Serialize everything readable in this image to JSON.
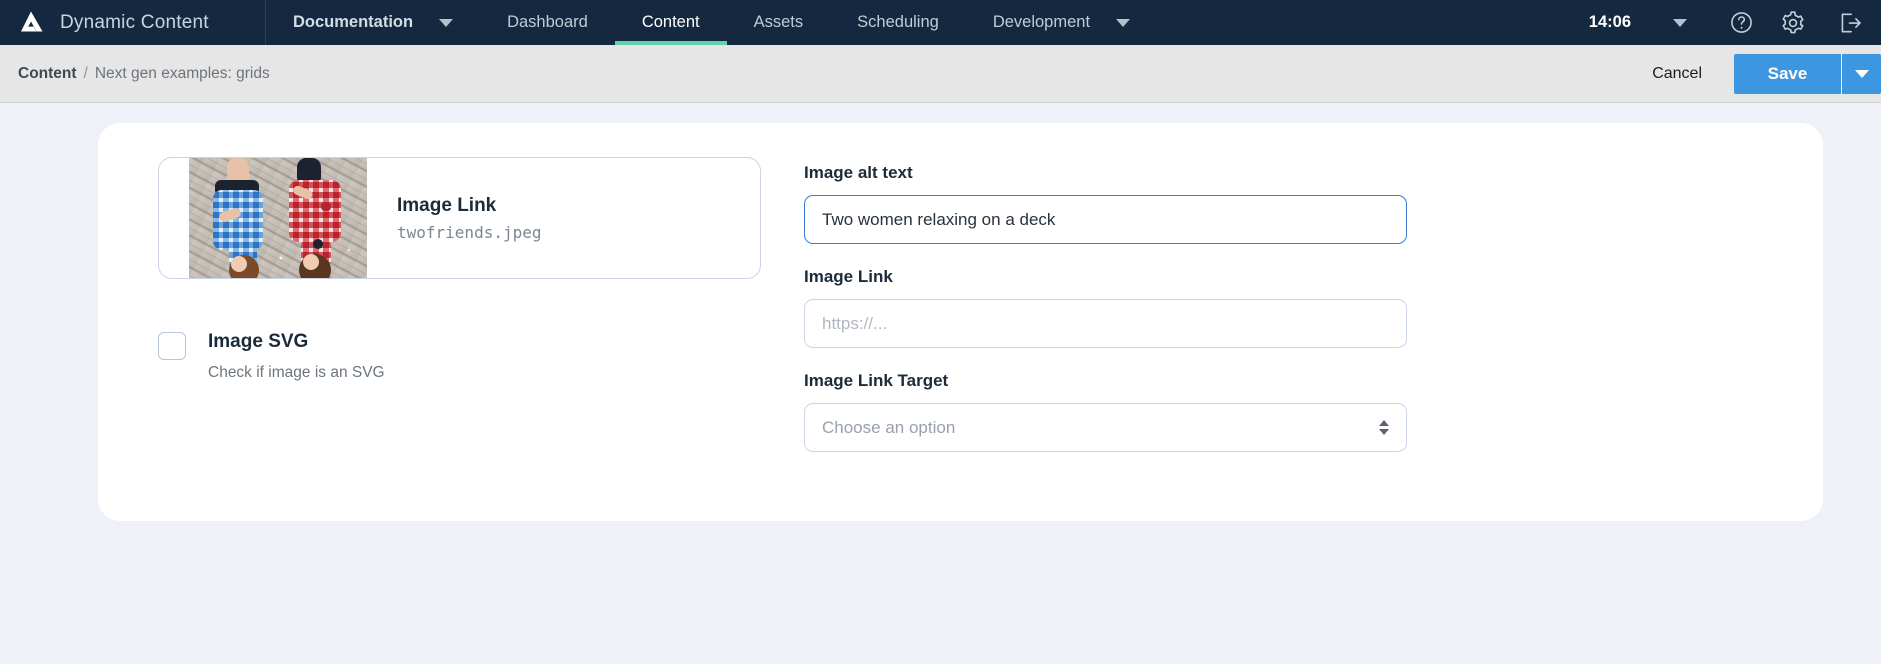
{
  "app": {
    "logo_icon": "delta-triangle-logo",
    "title": "Dynamic Content"
  },
  "topnav": {
    "tabs": [
      {
        "label": "Documentation",
        "icon": "chevron-down-icon",
        "has_caret": true,
        "bold": true,
        "active": false
      },
      {
        "label": "Dashboard",
        "has_caret": false,
        "bold": false,
        "active": false
      },
      {
        "label": "Content",
        "has_caret": false,
        "bold": false,
        "active": true
      },
      {
        "label": "Assets",
        "has_caret": false,
        "bold": false,
        "active": false
      },
      {
        "label": "Scheduling",
        "has_caret": false,
        "bold": false,
        "active": false
      },
      {
        "label": "Development",
        "icon": "chevron-down-icon",
        "has_caret": true,
        "bold": false,
        "active": false
      }
    ],
    "clock": "14:06",
    "clock_caret_icon": "chevron-down-icon",
    "icons": {
      "help": "help-circle-icon",
      "settings": "gear-icon",
      "signout": "sign-out-icon"
    },
    "accent_active": "#5fd3b0",
    "background": "#14293f"
  },
  "breadcrumb": {
    "root": "Content",
    "separator": "/",
    "leaf": "Next gen examples: grids"
  },
  "actions": {
    "cancel_label": "Cancel",
    "save_label": "Save",
    "save_dropdown_icon": "chevron-down-icon",
    "save_color": "#3d97e0"
  },
  "image_card": {
    "title": "Image Link",
    "filename": "twofriends.jpeg",
    "thumbnail_alt": "two women lying on a wooden deck"
  },
  "svg_checkbox": {
    "label": "Image SVG",
    "helper": "Check if image is an SVG",
    "checked": false
  },
  "fields": {
    "alt_text": {
      "label": "Image alt text",
      "value": "Two women relaxing on a deck",
      "placeholder": "",
      "focused": true
    },
    "image_link": {
      "label": "Image Link",
      "value": "",
      "placeholder": "https://..."
    },
    "image_link_target": {
      "label": "Image Link Target",
      "value": "Choose an option",
      "options": [
        "Choose an option"
      ],
      "stepper_icon": "up-down-chevron-icon"
    }
  }
}
